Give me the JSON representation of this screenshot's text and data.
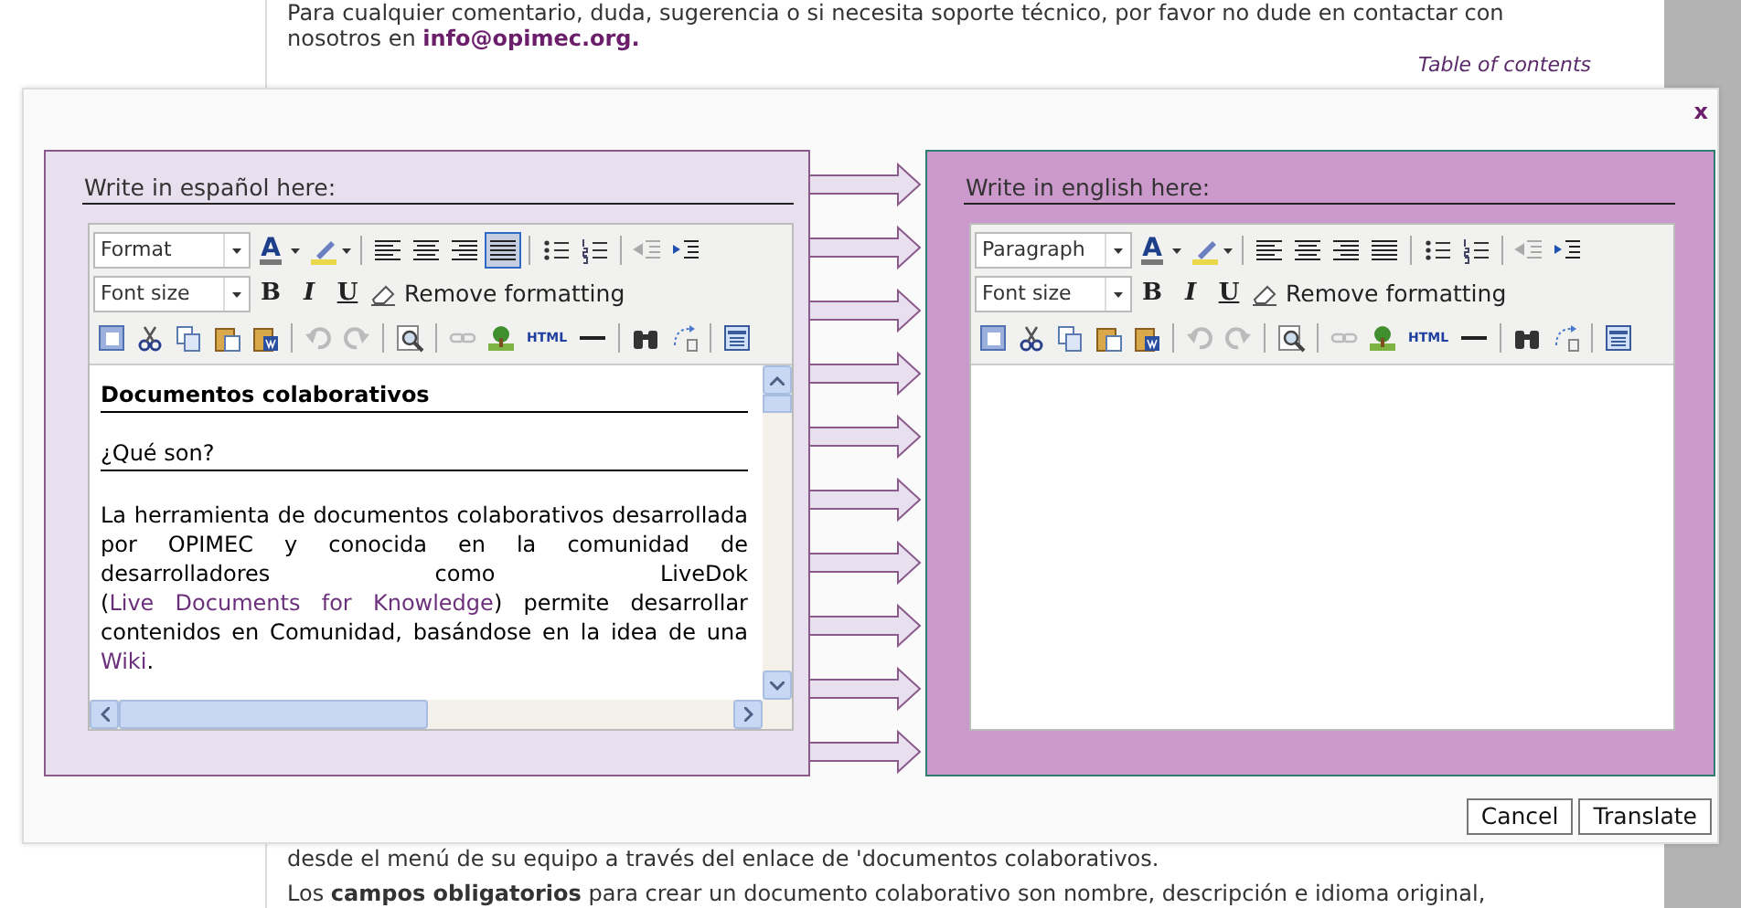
{
  "background_page": {
    "intro": [
      {
        "text": "Para cualquier comentario, duda, sugerencia o si necesita soporte técnico, por favor no dude en contactar con nosotros en "
      },
      {
        "text": "info@opimec.org.",
        "link": true
      }
    ],
    "toc_link": "Table of contents",
    "lines_below": [
      "desde el menú de su equipo a través del enlace de 'documentos colaborativos.",
      "Los **campos obligatorios** para crear un documento colaborativo son nombre, descripción e idioma original,"
    ]
  },
  "dialog": {
    "close": "x",
    "panels": [
      {
        "heading": "Write in español here:",
        "format": "Format",
        "font_size": "Font size",
        "font_color_label": "A",
        "bold": "B",
        "italic": "I",
        "underline": "U",
        "remove_formatting": "Remove formatting",
        "html_label": "HTML",
        "scrollbars": true,
        "alignment": [
          {
            "kind": "left",
            "selected": false
          },
          {
            "kind": "center",
            "selected": false
          },
          {
            "kind": "right",
            "selected": false
          },
          {
            "kind": "justify",
            "selected": true
          }
        ],
        "content": {
          "title": "Documentos colaborativos",
          "subtitle": "¿Qué son?",
          "paragraph": [
            {
              "text": "La herramienta de documentos colaborativos desarrollada por OPIMEC y conocida  en la comunidad de desarrolladores como LiveDok ("
            },
            {
              "text": "Live Documents for Knowledge",
              "link": true
            },
            {
              "text": ") permite desarrollar contenidos en Comunidad, basándose en la idea de una "
            },
            {
              "text": "Wiki",
              "link": true
            },
            {
              "text": "."
            }
          ]
        }
      },
      {
        "heading": "Write in english here:",
        "format": "Paragraph",
        "font_size": "Font size",
        "font_color_label": "A",
        "bold": "B",
        "italic": "I",
        "underline": "U",
        "remove_formatting": "Remove formatting",
        "html_label": "HTML",
        "scrollbars": false,
        "alignment": [
          {
            "kind": "left",
            "selected": false
          },
          {
            "kind": "center",
            "selected": false
          },
          {
            "kind": "right",
            "selected": false
          },
          {
            "kind": "justify",
            "selected": false
          }
        ]
      }
    ],
    "buttons": [
      "Cancel",
      "Translate"
    ]
  }
}
